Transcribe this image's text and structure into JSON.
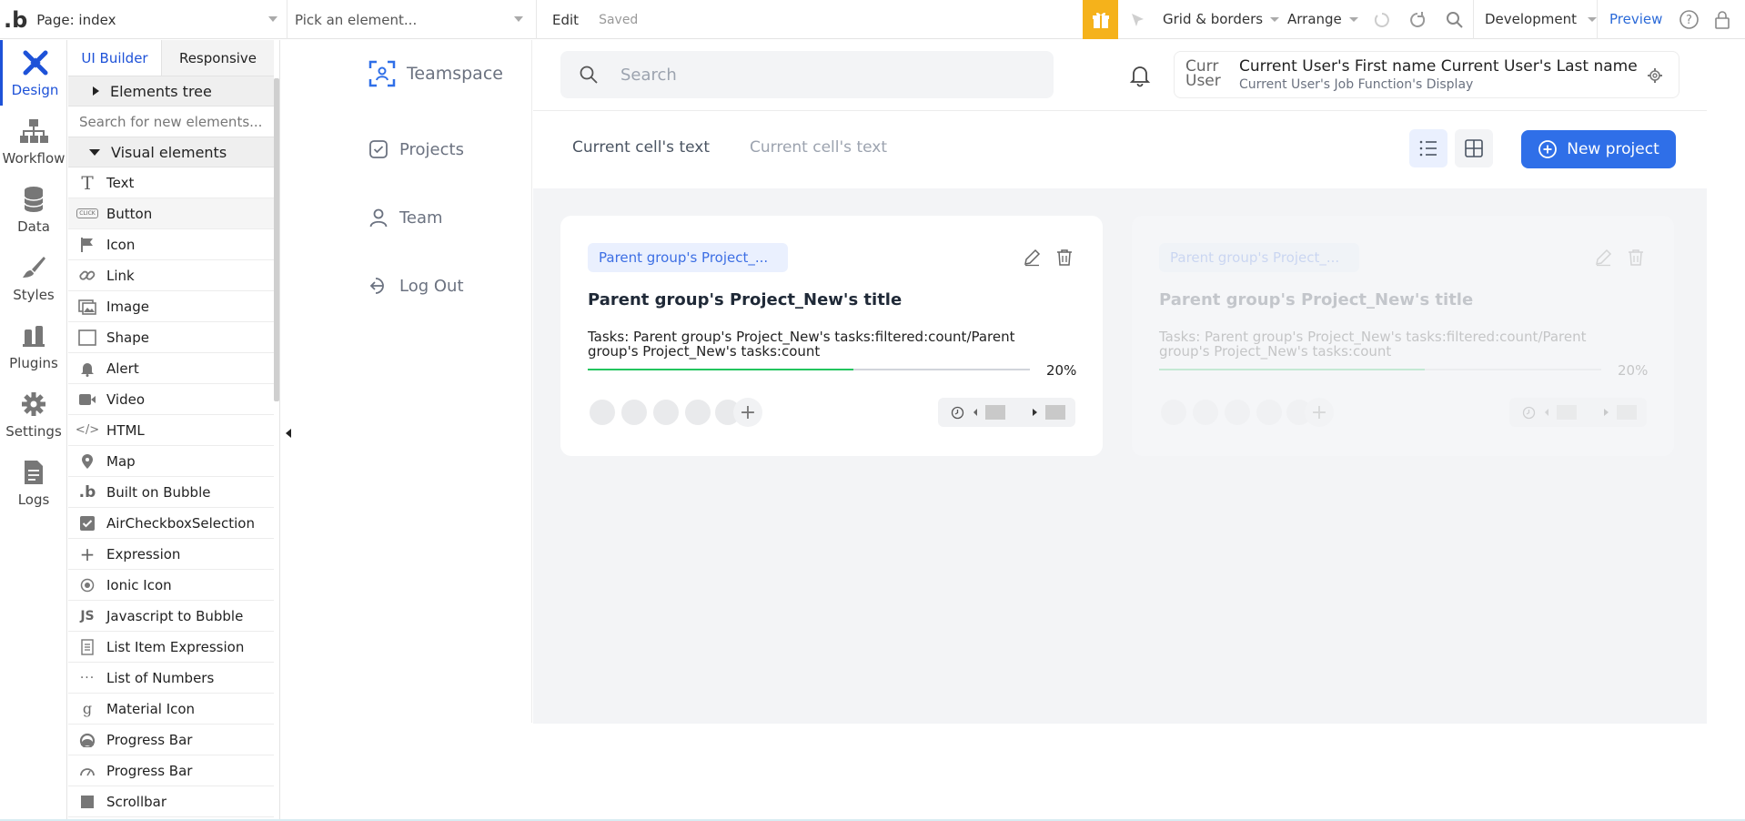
{
  "topbar": {
    "page_label": "Page: index",
    "element_picker": "Pick an element...",
    "edit": "Edit",
    "saved": "Saved",
    "grid": "Grid & borders",
    "arrange": "Arrange",
    "environment": "Development",
    "preview": "Preview"
  },
  "rail": [
    {
      "label": "Design",
      "icon": "design-icon"
    },
    {
      "label": "Workflow",
      "icon": "workflow-icon"
    },
    {
      "label": "Data",
      "icon": "database-icon"
    },
    {
      "label": "Styles",
      "icon": "brush-icon"
    },
    {
      "label": "Plugins",
      "icon": "plug-icon"
    },
    {
      "label": "Settings",
      "icon": "gear-icon"
    },
    {
      "label": "Logs",
      "icon": "document-icon"
    }
  ],
  "panel": {
    "tab_builder": "UI Builder",
    "tab_responsive": "Responsive",
    "elements_tree": "Elements tree",
    "search_placeholder": "Search for new elements...",
    "visual_elements": "Visual elements",
    "items": [
      {
        "label": "Text",
        "icon": "T"
      },
      {
        "label": "Button",
        "icon": "CLICK"
      },
      {
        "label": "Icon",
        "icon": "flag"
      },
      {
        "label": "Link",
        "icon": "link"
      },
      {
        "label": "Image",
        "icon": "image"
      },
      {
        "label": "Shape",
        "icon": "shape"
      },
      {
        "label": "Alert",
        "icon": "bell"
      },
      {
        "label": "Video",
        "icon": "video"
      },
      {
        "label": "HTML",
        "icon": "</>"
      },
      {
        "label": "Map",
        "icon": "pin"
      },
      {
        "label": "Built on Bubble",
        "icon": "b"
      },
      {
        "label": "AirCheckboxSelection",
        "icon": "check"
      },
      {
        "label": "Expression",
        "icon": "+"
      },
      {
        "label": "Ionic Icon",
        "icon": "ionic"
      },
      {
        "label": "Javascript to Bubble",
        "icon": "JS"
      },
      {
        "label": "List Item Expression",
        "icon": "list"
      },
      {
        "label": "List of Numbers",
        "icon": "..."
      },
      {
        "label": "Material Icon",
        "icon": "g"
      },
      {
        "label": "Progress Bar",
        "icon": "progress"
      },
      {
        "label": "Progress Bar",
        "icon": "gauge"
      },
      {
        "label": "Scrollbar",
        "icon": "square"
      }
    ]
  },
  "app": {
    "brand": "Teamspace",
    "nav": [
      "Projects",
      "Team",
      "Log Out"
    ],
    "search_placeholder": "Search",
    "user_avatar_text": "Curr User",
    "user_name": "Current User's First name Current User's Last name",
    "user_role": "Current User's Job Function's Display",
    "tabs": [
      "Current cell's text",
      "Current cell's text"
    ],
    "new_project": "New project",
    "cards": [
      {
        "chip": "Parent group's Project_...",
        "title": "Parent group's Project_New's title",
        "tasks": "Tasks: Parent group's Project_New's tasks:filtered:count/Parent group's Project_New's tasks:count",
        "progress": 0.6,
        "percent": "20%"
      },
      {
        "chip": "Parent group's Project_...",
        "title": "Parent group's Project_New's title",
        "tasks": "Tasks: Parent group's Project_New's tasks:filtered:count/Parent group's Project_New's tasks:count",
        "progress": 0.6,
        "percent": "20%"
      }
    ]
  },
  "colors": {
    "accent": "#1e52d8",
    "primary_button": "#2f6fe8",
    "gift": "#f5b21b",
    "progress": "#22c55e"
  }
}
